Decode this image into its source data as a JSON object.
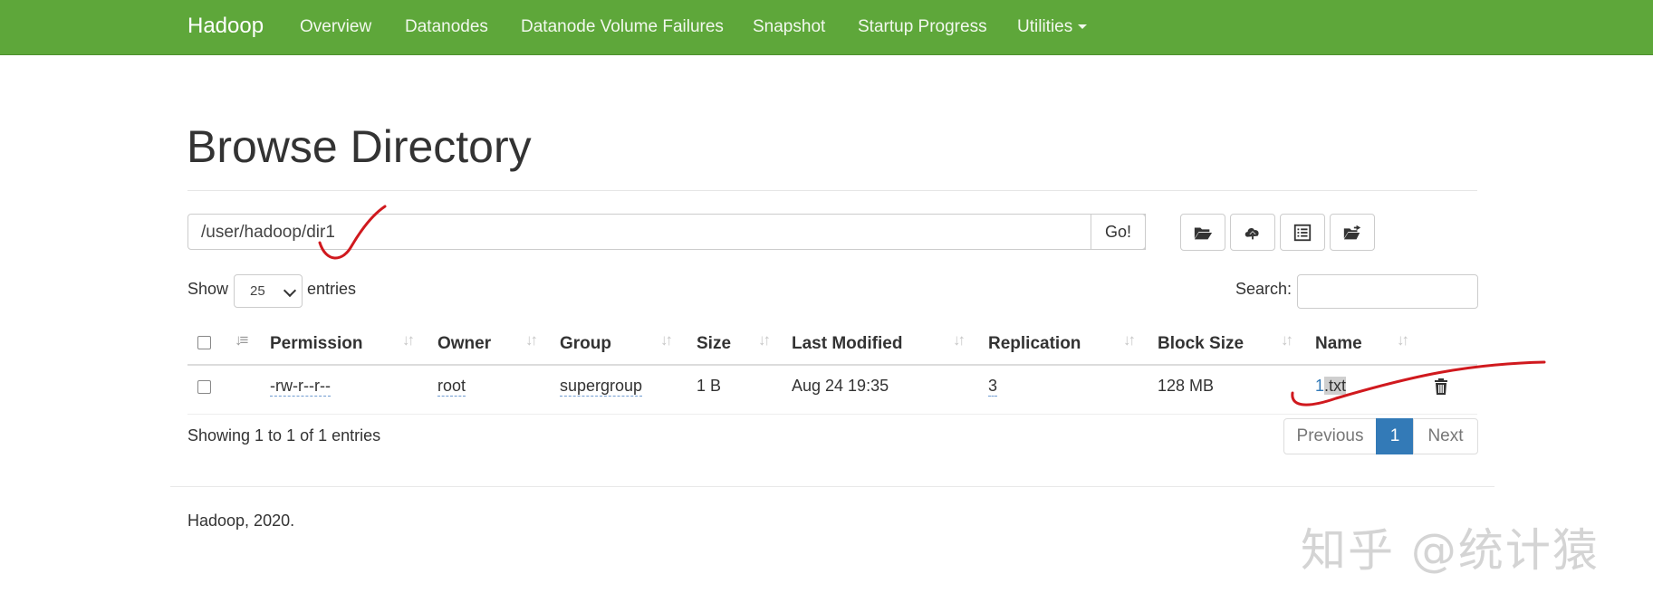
{
  "navbar": {
    "brand": "Hadoop",
    "items": [
      "Overview",
      "Datanodes",
      "Datanode Volume Failures",
      "Snapshot",
      "Startup Progress",
      "Utilities"
    ]
  },
  "page": {
    "title": "Browse Directory"
  },
  "path_bar": {
    "value": "/user/hadoop/dir1",
    "go_label": "Go!"
  },
  "toolbar": {
    "icons": [
      "folder-open-icon",
      "upload-icon",
      "list-alt-icon",
      "folder-move-icon"
    ]
  },
  "table_controls": {
    "show_label": "Show",
    "page_size": "25",
    "entries_label": "entries",
    "search_label": "Search:"
  },
  "table": {
    "columns": [
      "Permission",
      "Owner",
      "Group",
      "Size",
      "Last Modified",
      "Replication",
      "Block Size",
      "Name"
    ],
    "rows": [
      {
        "permission": "-rw-r--r--",
        "owner": "root",
        "group": "supergroup",
        "size": "1 B",
        "last_modified": "Aug 24 19:35",
        "replication": "3",
        "block_size": "128 MB",
        "name_prefix": "1",
        "name_suffix": ".txt"
      }
    ]
  },
  "pagination": {
    "summary": "Showing 1 to 1 of 1 entries",
    "previous": "Previous",
    "current": "1",
    "next": "Next"
  },
  "footer": {
    "text": "Hadoop, 2020."
  },
  "watermark": {
    "text": "知乎 @统计猿"
  },
  "colors": {
    "navbar": "#5ea73a",
    "primary": "#337ab7",
    "annotation": "#d0191e"
  }
}
